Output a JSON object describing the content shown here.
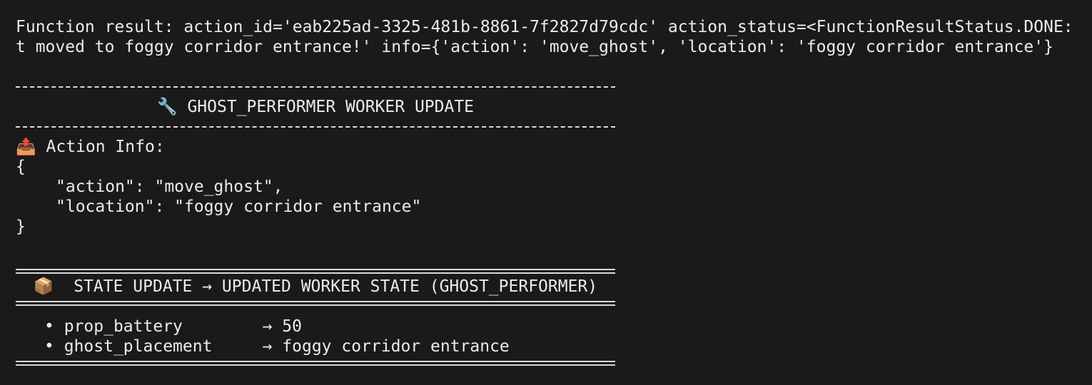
{
  "terminal": {
    "function_result_line1": "Function result: action_id='eab225ad-3325-481b-8861-7f2827d79cdc' action_status=<FunctionResultStatus.DONE:",
    "function_result_line2": "t moved to foggy corridor entrance!' info={'action': 'move_ghost', 'location': 'foggy corridor entrance'}",
    "worker_update": {
      "icon": "🔧",
      "title": "GHOST_PERFORMER WORKER UPDATE"
    },
    "action_info": {
      "icon": "📤",
      "label": "Action Info:",
      "open_brace": "{",
      "line_action": "\"action\": \"move_ghost\",",
      "line_location": "\"location\": \"foggy corridor entrance\"",
      "close_brace": "}"
    },
    "state_update": {
      "icon": "📦",
      "title": "STATE UPDATE → UPDATED WORKER STATE (GHOST_PERFORMER)"
    },
    "state_items": [
      {
        "bullet": "•",
        "key": "prop_battery",
        "arrow": "→",
        "value": "50"
      },
      {
        "bullet": "•",
        "key": "ghost_placement",
        "arrow": "→",
        "value": "foggy corridor entrance"
      }
    ]
  }
}
